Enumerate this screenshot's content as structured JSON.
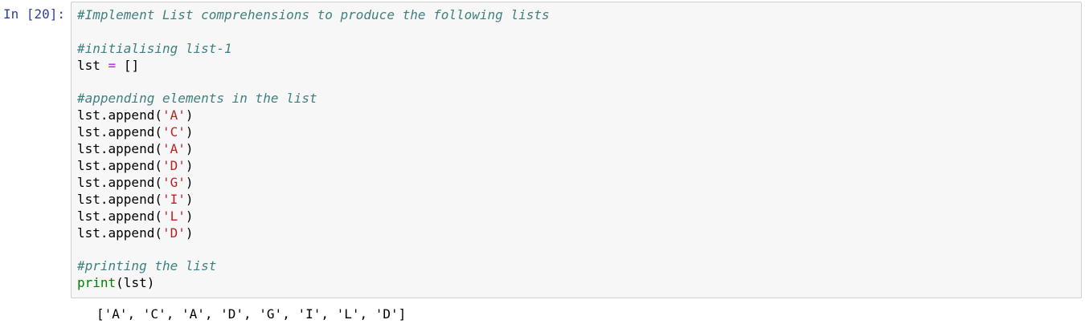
{
  "cell": {
    "prompt": "In [20]:",
    "lines": {
      "l1_comment": "#Implement List comprehensions to produce the following lists",
      "l3_comment": "#initialising list-1",
      "l4_var": "lst",
      "l4_op": "=",
      "l4_value": "[]",
      "l6_comment": "#appending elements in the list",
      "append_prefix": "lst.append(",
      "append_suffix": ")",
      "append_args": [
        "'A'",
        "'C'",
        "'A'",
        "'D'",
        "'G'",
        "'I'",
        "'L'",
        "'D'"
      ],
      "print_func": "print",
      "print_args": "(lst)",
      "print_comment": "#printing the list"
    },
    "output": "['A', 'C', 'A', 'D', 'G', 'I', 'L', 'D']"
  }
}
